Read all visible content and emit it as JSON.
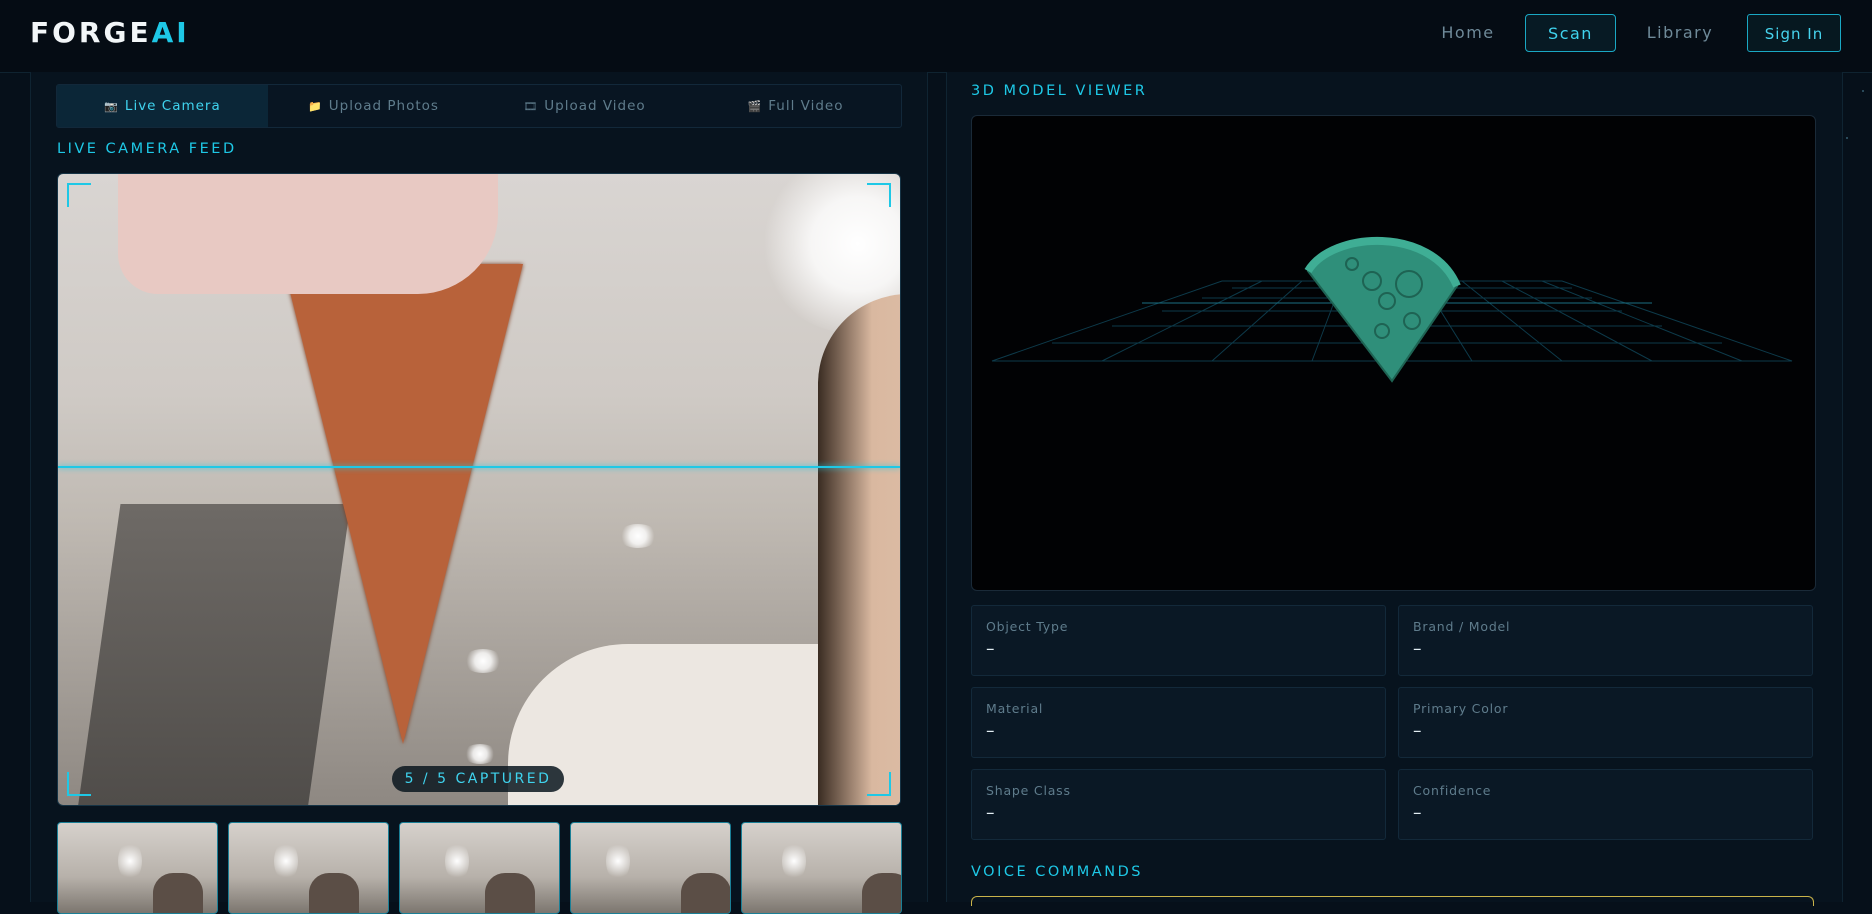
{
  "nav": {
    "logo_main": "FORGE",
    "logo_accent": "AI",
    "links": [
      "Home",
      "Scan",
      "Library"
    ],
    "active_link": "Scan",
    "signin": "Sign In"
  },
  "tabs": [
    {
      "icon": "camera-icon",
      "glyph": "📷",
      "label": "Live Camera",
      "active": true
    },
    {
      "icon": "folder-icon",
      "glyph": "📁",
      "label": "Upload Photos",
      "active": false
    },
    {
      "icon": "film-icon",
      "glyph": "🎞",
      "label": "Upload Video",
      "active": false
    },
    {
      "icon": "video-icon",
      "glyph": "🎬",
      "label": "Full Video",
      "active": false
    }
  ],
  "camera": {
    "title": "LIVE CAMERA FEED",
    "captured_badge": "5 / 5 CAPTURED"
  },
  "viewer": {
    "title": "3D MODEL VIEWER"
  },
  "info": [
    {
      "label": "Object Type",
      "value": "–"
    },
    {
      "label": "Brand / Model",
      "value": "–"
    },
    {
      "label": "Material",
      "value": "–"
    },
    {
      "label": "Primary Color",
      "value": "–"
    },
    {
      "label": "Shape Class",
      "value": "–"
    },
    {
      "label": "Confidence",
      "value": "–"
    }
  ],
  "voice": {
    "title": "VOICE COMMANDS"
  },
  "colors": {
    "accent": "#1ec8e6",
    "background": "#06101a",
    "model": "#2f8f7a",
    "voice_border": "#c9b34a"
  }
}
